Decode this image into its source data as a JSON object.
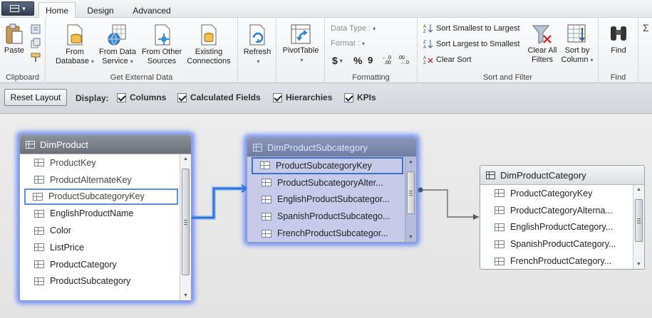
{
  "tabs": [
    {
      "label": "Home",
      "active": true
    },
    {
      "label": "Design",
      "active": false
    },
    {
      "label": "Advanced",
      "active": false
    }
  ],
  "ribbon": {
    "clipboard": {
      "label": "Clipboard",
      "paste": "Paste"
    },
    "get_external_data": {
      "label": "Get External Data",
      "from_database": "From\nDatabase",
      "from_data_service": "From Data\nService",
      "from_other_sources": "From Other\nSources",
      "existing_connections": "Existing\nConnections"
    },
    "refresh": "Refresh",
    "pivottable": "PivotTable",
    "formatting": {
      "label": "Formatting",
      "data_type": "Data Type :",
      "format": "Format :",
      "currency": "$",
      "percent": "%",
      "comma": "9"
    },
    "sort_filter": {
      "label": "Sort and Filter",
      "sort_smallest": "Sort Smallest to Largest",
      "sort_largest": "Sort Largest to Smallest",
      "clear_sort": "Clear Sort",
      "clear_all_filters": "Clear All\nFilters",
      "sort_by_column": "Sort by\nColumn"
    },
    "find": {
      "label": "Find",
      "button": "Find"
    }
  },
  "display_bar": {
    "reset_layout": "Reset Layout",
    "display_label": "Display:",
    "options": [
      {
        "label": "Columns",
        "checked": true
      },
      {
        "label": "Calculated Fields",
        "checked": true
      },
      {
        "label": "Hierarchies",
        "checked": true
      },
      {
        "label": "KPIs",
        "checked": true
      }
    ]
  },
  "tables": {
    "dim_product": {
      "name": "DimProduct",
      "columns": [
        "ProductKey",
        "ProductAlternateKey",
        "ProductSubcategoryKey",
        "EnglishProductName",
        "Color",
        "ListPrice",
        "ProductCategory",
        "ProductSubcategory"
      ]
    },
    "dim_product_subcategory": {
      "name": "DimProductSubcategory",
      "columns": [
        "ProductSubcategoryKey",
        "ProductSubcategoryAlter...",
        "EnglishProductSubcategor...",
        "SpanishProductSubcatego...",
        "FrenchProductSubcategor..."
      ]
    },
    "dim_product_category": {
      "name": "DimProductCategory",
      "columns": [
        "ProductCategoryKey",
        "ProductCategoryAlterna...",
        "EnglishProductCategory...",
        "SpanishProductCategory...",
        "FrenchProductCategory..."
      ]
    }
  }
}
